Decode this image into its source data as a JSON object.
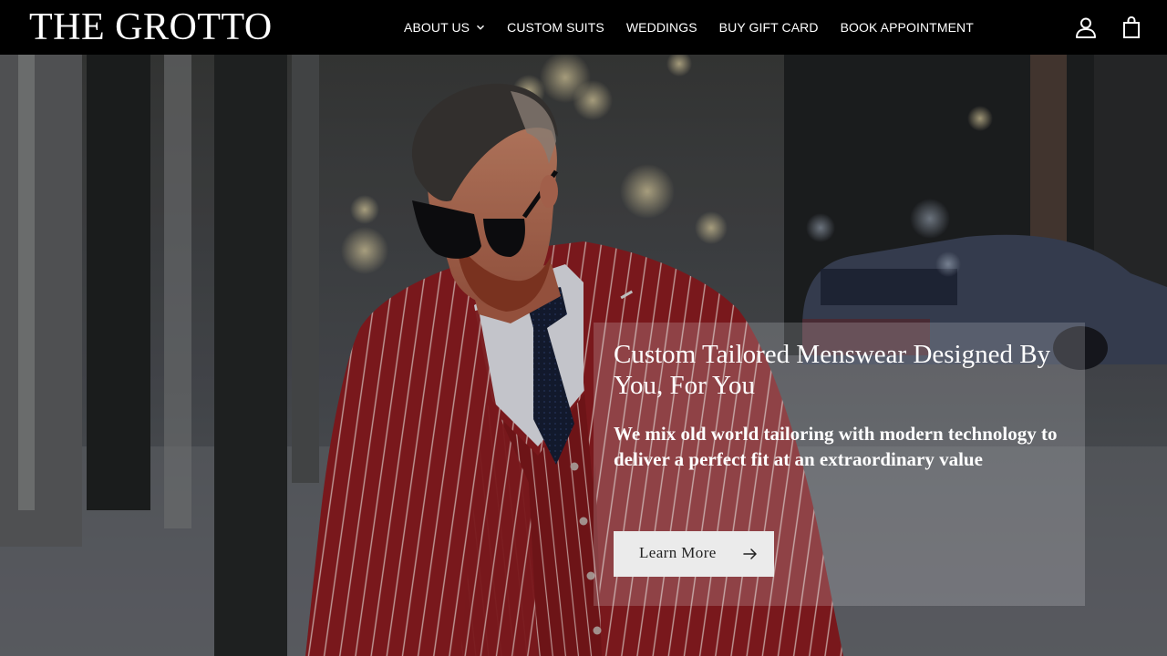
{
  "brand": {
    "name": "THE GROTTO"
  },
  "nav": {
    "items": [
      {
        "label": "ABOUT US",
        "has_dropdown": true,
        "icon": "chevron-down-icon"
      },
      {
        "label": "CUSTOM SUITS"
      },
      {
        "label": "WEDDINGS"
      },
      {
        "label": "BUY GIFT CARD"
      },
      {
        "label": "BOOK APPOINTMENT"
      }
    ]
  },
  "header_icons": {
    "account": "account-icon",
    "cart": "shopping-bag-icon"
  },
  "hero": {
    "heading": "Custom Tailored Menswear Designed By You, For You",
    "subheading": "We mix old world tailoring with modern technology to deliver a perfect fit at an extraordinary value",
    "cta_label": "Learn More",
    "cta_icon": "arrow-right-icon",
    "image_subject": "man in red pinstripe three-piece suit with sunglasses on a city sidewalk"
  },
  "colors": {
    "header_bg": "#000000",
    "text_light": "#ffffff",
    "suit_red": "#8c1e22",
    "cta_bg": "#ebebeb"
  }
}
